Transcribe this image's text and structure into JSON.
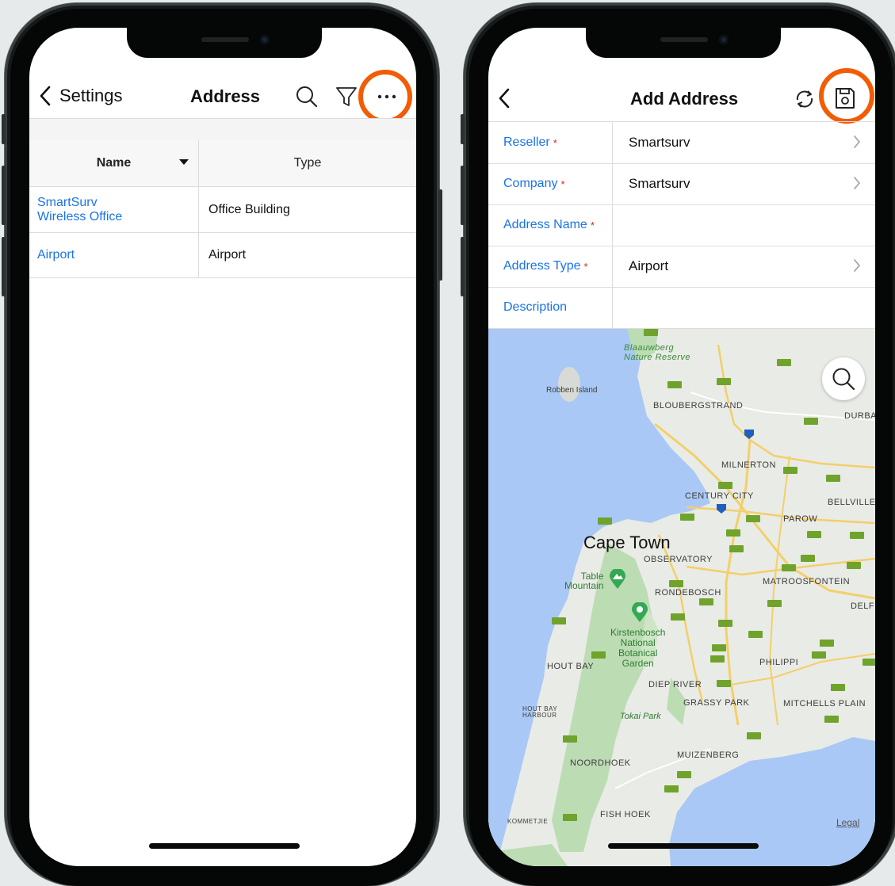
{
  "left_screen": {
    "nav": {
      "back_label": "Settings",
      "title": "Address"
    },
    "table": {
      "columns": [
        "Name",
        "Type"
      ],
      "rows": [
        {
          "name": "SmartSurv\nWireless Office",
          "type": "Office Building"
        },
        {
          "name": "Airport",
          "type": "Airport"
        }
      ]
    }
  },
  "right_screen": {
    "nav": {
      "title": "Add Address"
    },
    "form": [
      {
        "label": "Reseller",
        "required": "*",
        "value": "Smartsurv",
        "has_chevron": true
      },
      {
        "label": "Company",
        "required": "*",
        "value": "Smartsurv",
        "has_chevron": true
      },
      {
        "label": "Address Name",
        "required": "*",
        "value": "",
        "has_chevron": false
      },
      {
        "label": "Address Type",
        "required": "*",
        "value": "Airport",
        "has_chevron": true
      },
      {
        "label": "Description",
        "required": "",
        "value": "",
        "has_chevron": false
      }
    ],
    "map": {
      "labels": {
        "blaauwberg": "Blaauwberg\nNature Reserve",
        "robben": "Robben Island",
        "bloubergstrand": "BLOUBERGSTRAND",
        "durban": "DURBA",
        "milnerton": "MILNERTON",
        "century_city": "CENTURY CITY",
        "bellville": "BELLVILLE",
        "parow": "PAROW",
        "cape_town": "Cape Town",
        "observatory": "OBSERVATORY",
        "table_mountain": "Table\nMountain",
        "matroosfontein": "MATROOSFONTEIN",
        "rondebosch": "RONDEBOSCH",
        "delft": "DELF",
        "kirstenbosch": "Kirstenbosch\nNational\nBotanical\nGarden",
        "hout_bay": "HOUT BAY",
        "philippi": "PHILIPPI",
        "diep_river": "DIEP RIVER",
        "grassy_park": "GRASSY PARK",
        "mitchells_plain": "MITCHELLS PLAIN",
        "hout_bay_harbour": "HOUT BAY\nHARBOUR",
        "tokai_park": "Tokai Park",
        "muizenberg": "MUIZENBERG",
        "noordhoek": "NOORDHOEK",
        "fish_hoek": "FISH HOEK",
        "kommetjie": "KOMMETJIE",
        "legal": "Legal"
      }
    }
  },
  "colors": {
    "accent": "#1a73e8",
    "highlight_ring": "#f25c05",
    "required": "#e2231a",
    "water": "#a9c8f5",
    "land": "#e8eae6",
    "park": "#bcdcb4"
  }
}
